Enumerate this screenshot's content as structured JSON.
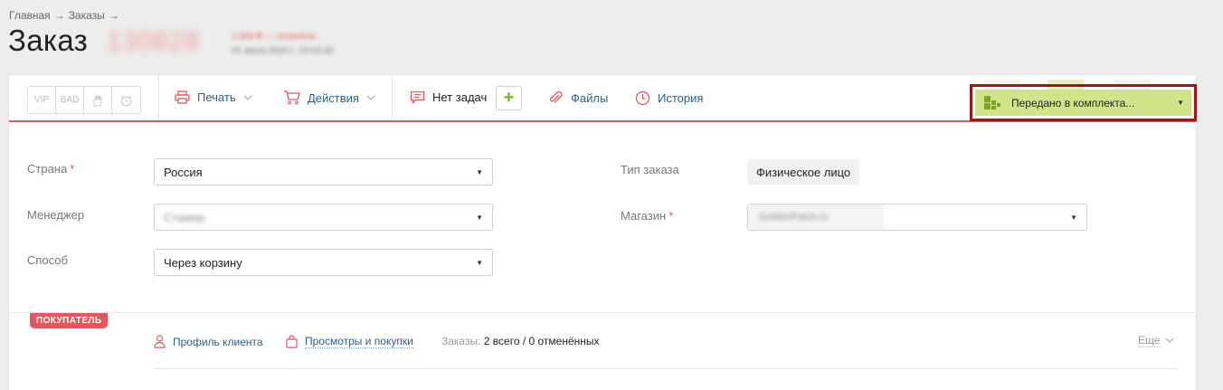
{
  "breadcrumb": {
    "home": "Главная",
    "orders": "Заказы",
    "sep": "→"
  },
  "page": {
    "title": "Заказ",
    "order_number": "130828",
    "order_sum": "2 800 ₽ — оплачено",
    "order_date": "01 июля 2020 г. 15:53:30"
  },
  "toolbar": {
    "flags": [
      "VIP",
      "BAD"
    ],
    "print_label": "Печать",
    "actions_label": "Действия",
    "tasks_label": "Нет задач",
    "add_task_symbol": "+",
    "files_label": "Файлы",
    "history_label": "История",
    "status_label": "Передано в комплекта..."
  },
  "form": {
    "country": {
      "label": "Страна",
      "value": "Россия"
    },
    "manager": {
      "label": "Менеджер",
      "value": "Стажер"
    },
    "method": {
      "label": "Способ",
      "value": "Через корзину"
    },
    "order_type": {
      "label": "Тип заказа",
      "value": "Физическое лицо"
    },
    "shop": {
      "label": "Магазин",
      "value": "GoldenPatch.ru"
    },
    "required_mark": "*"
  },
  "customer": {
    "badge": "ПОКУПАТЕЛЬ",
    "profile_link": "Профиль клиента",
    "views_link": "Просмотры и покупки",
    "orders_label": "Заказы:",
    "orders_value": "2 всего / 0 отменённых",
    "more_label": "Еще"
  },
  "colors": {
    "accent": "#e0585d",
    "status_bg": "#d2e48a",
    "link": "#2c5e8a",
    "highlight_border": "#a01616"
  }
}
